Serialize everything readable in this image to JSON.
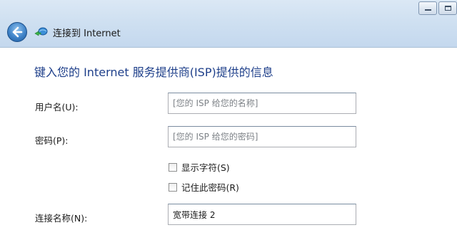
{
  "window": {
    "title": "连接到 Internet",
    "controls": {
      "minimize_icon": "minimize-icon",
      "maximize_icon": "maximize-icon"
    },
    "back_icon": "back-arrow-icon",
    "app_icon": "network-connection-icon"
  },
  "form": {
    "heading": "键入您的 Internet 服务提供商(ISP)提供的信息",
    "username": {
      "label": "用户名(U):",
      "placeholder": "[您的 ISP 给您的名称]",
      "value": ""
    },
    "password": {
      "label": "密码(P):",
      "placeholder": "[您的 ISP 给您的密码]",
      "value": ""
    },
    "show_chars": {
      "label": "显示字符(S)",
      "checked": false
    },
    "remember_password": {
      "label": "记住此密码(R)",
      "checked": false
    },
    "connection_name": {
      "label": "连接名称(N):",
      "value": "宽带连接 2"
    }
  },
  "colors": {
    "heading": "#1e3f8a",
    "titlebar": "#cfe0f1",
    "back_button": "#3f83c8"
  }
}
